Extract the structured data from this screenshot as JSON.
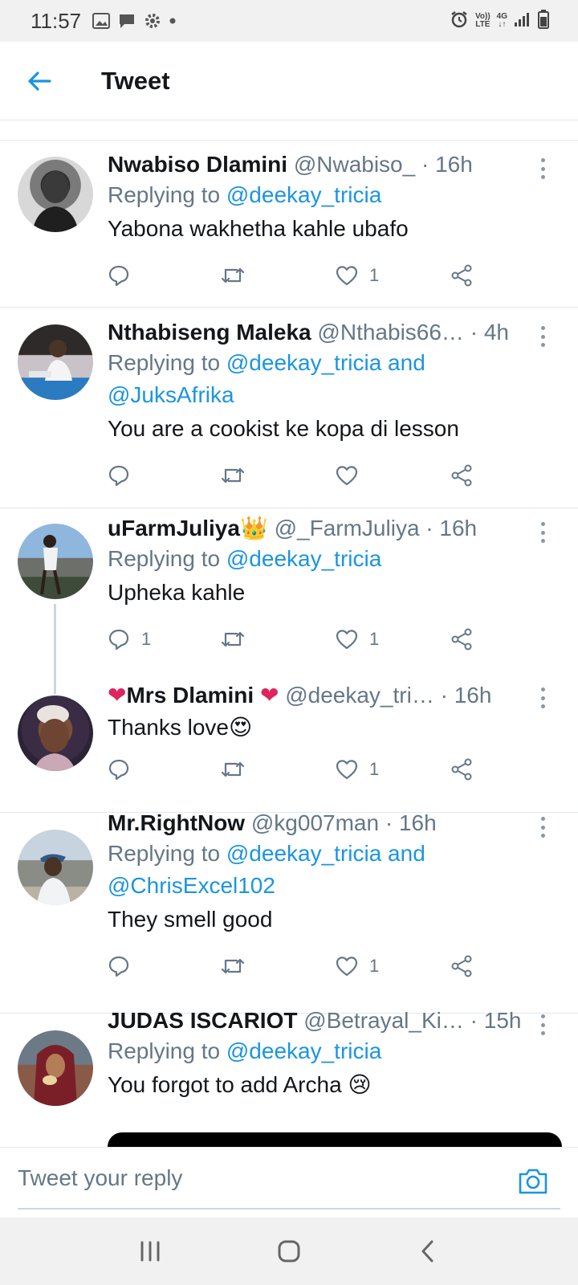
{
  "status_bar": {
    "time": "11:57",
    "network_top": "Vo))",
    "network_bottom": "LTE",
    "signal_label": "4G"
  },
  "app_bar": {
    "title": "Tweet"
  },
  "tweets": [
    {
      "name": "Nwabiso Dlamini",
      "handle": "@Nwabiso_",
      "time": "16h",
      "reply_prefix": "Replying to",
      "reply_to": "@deekay_tricia",
      "text": "Yabona wakhetha kahle ubafo",
      "reply_count": "",
      "like_count": "1"
    },
    {
      "name": "Nthabiseng Maleka",
      "handle": "@Nthabis66…",
      "time": "4h",
      "reply_prefix": "Replying to",
      "reply_to": "@deekay_tricia and",
      "reply_to_2": "@JuksAfrika",
      "text": "You are a cookist ke kopa di lesson",
      "reply_count": "",
      "like_count": ""
    },
    {
      "name": "uFarmJuliya",
      "name_emoji": "👑",
      "handle": "@_FarmJuliya",
      "time": "16h",
      "reply_prefix": "Replying to",
      "reply_to": "@deekay_tricia",
      "text": "Upheka kahle",
      "reply_count": "1",
      "like_count": "1"
    },
    {
      "name_prefix": "❤",
      "name": "Mrs Dlamini ",
      "name_suffix": "❤",
      "handle": "@deekay_tri…",
      "time": "16h",
      "text": "Thanks love",
      "text_emoji": "😍",
      "reply_count": "",
      "like_count": "1"
    },
    {
      "name": "Mr.RightNow",
      "handle": "@kg007man",
      "time": "16h",
      "reply_prefix": "Replying to",
      "reply_to": "@deekay_tricia and",
      "reply_to_2": "@ChrisExcel102",
      "text": "They smell good",
      "reply_count": "",
      "like_count": "1"
    },
    {
      "name": "JUDAS ISCARIOT",
      "handle": "@Betrayal_Ki…",
      "time": "15h",
      "reply_prefix": "Replying to",
      "reply_to": "@deekay_tricia",
      "text": "You forgot to add Archa",
      "text_emoji": "😢"
    }
  ],
  "reply_bar": {
    "placeholder": "Tweet your reply"
  },
  "colors": {
    "link": "#1b95e0",
    "muted": "#657786",
    "heart_red": "#e0245e"
  },
  "icons": [
    "back-arrow-icon",
    "reply-icon",
    "retweet-icon",
    "like-icon",
    "share-icon",
    "more-icon",
    "camera-icon"
  ]
}
